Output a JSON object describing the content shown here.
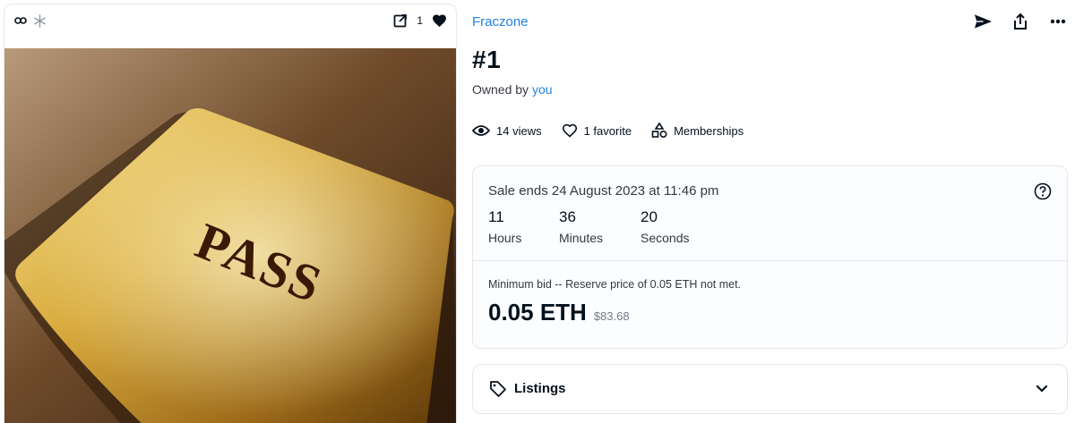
{
  "media": {
    "favorite_count": "1",
    "image_text": "PASS"
  },
  "item": {
    "collection_name": "Fraczone",
    "title": "#1",
    "owned_by_label": "Owned by",
    "owner": "you"
  },
  "stats": {
    "views": "14 views",
    "favorites": "1 favorite",
    "memberships": "Memberships"
  },
  "sale": {
    "ends_text": "Sale ends 24 August 2023 at 11:46 pm",
    "countdown": [
      {
        "value": "11",
        "label": "Hours"
      },
      {
        "value": "36",
        "label": "Minutes"
      },
      {
        "value": "20",
        "label": "Seconds"
      }
    ],
    "min_bid_text": "Minimum bid -- Reserve price of 0.05 ETH not met.",
    "price": "0.05 ETH",
    "price_usd": "$83.68"
  },
  "listings": {
    "label": "Listings"
  },
  "colors": {
    "link": "#2081e2",
    "text": "#04111d",
    "border": "#e5e8eb"
  },
  "icons": [
    "link-icon",
    "snowflake-icon",
    "open-external-icon",
    "heart-filled-icon",
    "send-icon",
    "share-icon",
    "more-icon",
    "eye-icon",
    "heart-outline-icon",
    "shapes-icon",
    "help-icon",
    "tag-icon",
    "chevron-down-icon"
  ]
}
